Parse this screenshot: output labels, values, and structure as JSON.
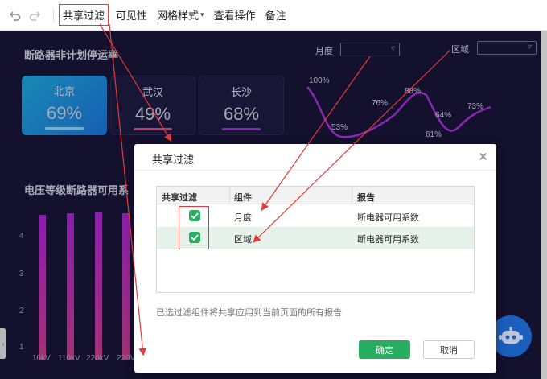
{
  "toolbar": {
    "items": [
      "共享过滤",
      "可见性",
      "网格样式",
      "查看操作",
      "备注"
    ]
  },
  "dashboard": {
    "section1_title": "断路器非计划停运率",
    "filter_month_label": "月度",
    "filter_region_label": "区域",
    "kpis": [
      {
        "name": "北京",
        "value": "69%"
      },
      {
        "name": "武汉",
        "value": "49%"
      },
      {
        "name": "长沙",
        "value": "68%"
      }
    ],
    "section2_title": "电压等级断路器可用系",
    "line_labels": [
      "100%",
      "53%",
      "76%",
      "88%",
      "61%",
      "64%",
      "73%"
    ],
    "bar_axis_ticks": [
      "4",
      "3",
      "2",
      "1"
    ],
    "bar_x_labels": [
      "10kV",
      "110kV",
      "220kV",
      "220V"
    ]
  },
  "modal": {
    "title": "共享过滤",
    "columns": [
      "共享过滤",
      "组件",
      "报告"
    ],
    "rows": [
      {
        "component": "月度",
        "report": "断电器可用系数"
      },
      {
        "component": "区域",
        "report": "断电器可用系数"
      }
    ],
    "hint": "已选过滤组件将共享应用到当前页面的所有报告",
    "ok_label": "确定",
    "cancel_label": "取消"
  },
  "colors": {
    "dashboard_bg": "#181537",
    "accent_green": "#27ae60",
    "highlight_red": "#e53935"
  }
}
